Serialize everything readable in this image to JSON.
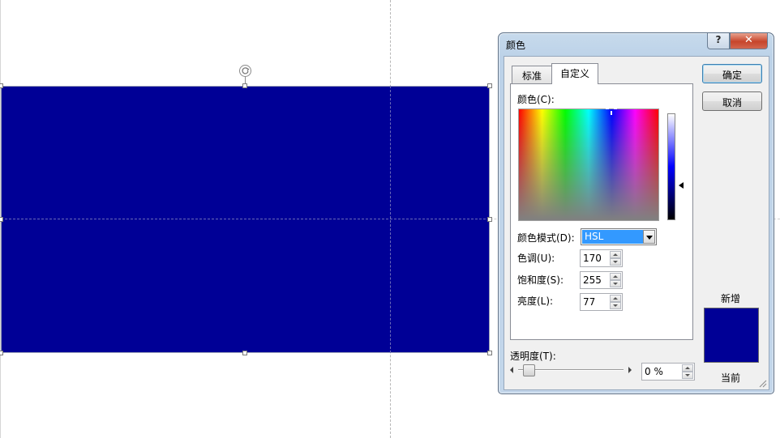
{
  "slide": {
    "shape_fill": "#000096"
  },
  "dialog": {
    "title": "颜色",
    "help_glyph": "?",
    "close_glyph": "✕",
    "tabs": [
      {
        "label": "标准",
        "selected": false
      },
      {
        "label": "自定义",
        "selected": true
      }
    ],
    "colors_label": "颜色(C):",
    "color_mode": {
      "label": "颜色模式(D):",
      "value": "HSL"
    },
    "hue": {
      "label": "色调(U):",
      "value": "170"
    },
    "saturation": {
      "label": "饱和度(S):",
      "value": "255"
    },
    "luminance": {
      "label": "亮度(L):",
      "value": "77"
    },
    "transparency": {
      "label": "透明度(T):",
      "value": "0 %",
      "level": 0
    },
    "ok_label": "确定",
    "cancel_label": "取消",
    "preview": {
      "new_label": "新增",
      "current_label": "当前",
      "new_color": "#000096",
      "current_color": "#000096"
    }
  }
}
